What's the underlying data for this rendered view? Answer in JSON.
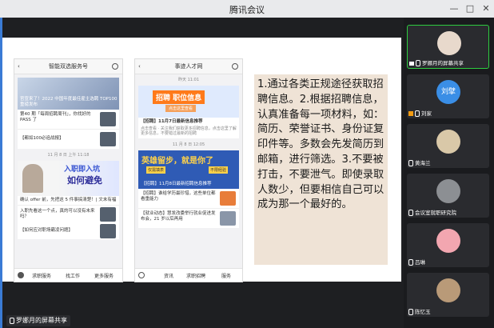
{
  "window": {
    "title": "腾讯会议",
    "minimize": "—",
    "maximize": "□",
    "close": "✕"
  },
  "share_tag": "罗娜月的屏幕共享",
  "slide": {
    "phone1": {
      "header": "智能双选服务号",
      "banner_text": "官宣来了！2022 中国年度最佳雇主选聘 TOP100 重磅发布",
      "item1": "第40 期「每周招聘周刊」，你找好的 PASS 了",
      "item2": "【都如100必追战报】",
      "date": "11 月 8 日 上午 11:18",
      "card2_title1": "入职即入坑",
      "card2_title2": "如何避免",
      "card2_sub": "确认 offer 前，先把这 5 件事搞清楚！| 文末有福",
      "item3": "入职先看这一个点，真的可以没有未来吗？",
      "item4": "【如何应对职场霸凌问题】",
      "bottom": [
        "求职服务",
        "找工作",
        "更多服务"
      ]
    },
    "phone2": {
      "header": "事迹人才网",
      "date1": "昨天 11:01",
      "badge1": "招聘 职位信息",
      "badge1_sub": "点击这里查看",
      "post1": "【招聘】11月7日最新信息推荐",
      "post1_text": "点击查看 · 关注我们获取更多招聘信息，点击这里了解更多信息，不要错过最新的招聘",
      "date2": "11 月 8 日 12:05",
      "banner2_title": "英雄留步，就是你了",
      "banner2_tags": [
        "仅需填表",
        "不限经验"
      ],
      "post2": "【招聘】11月8日最新招聘信息推荐",
      "post3": "【招聘】谁给学历最珍惜，这些单位都看重能力",
      "post4": "【就业动态】慧发改委举行就业促进发布会，21 岁以后再用",
      "bottom": [
        "资讯",
        "求职招聘",
        "服务"
      ]
    },
    "text": "1.通过各类正规途径获取招聘信息。2.根据招聘信息，认真准备每一项材料，如：简历、荣誉证书、身份证复印件等。多数会先发简历到邮箱，进行筛选。3.不要被打击，不要泄气。即使录取人数少，但要相信自己可以成为那一个最好的。"
  },
  "participants": [
    {
      "name": "罗娜月的屏幕共享",
      "avatar_color": "#e8d9cc",
      "avatar_text": "",
      "active": true
    },
    {
      "name": "刘家",
      "avatar_color": "#3a8ee6",
      "avatar_text": "刘擘",
      "active": false
    },
    {
      "name": "黄海兰",
      "avatar_color": "#d9c8a8",
      "avatar_text": "",
      "active": false
    },
    {
      "name": "会议室就职研究院",
      "avatar_color": "#8c8f93",
      "avatar_text": "",
      "active": false
    },
    {
      "name": "吕琳",
      "avatar_color": "#f2a6b0",
      "avatar_text": "",
      "active": false
    },
    {
      "name": "陈忆玉",
      "avatar_color": "#b99a78",
      "avatar_text": "",
      "active": false
    }
  ]
}
